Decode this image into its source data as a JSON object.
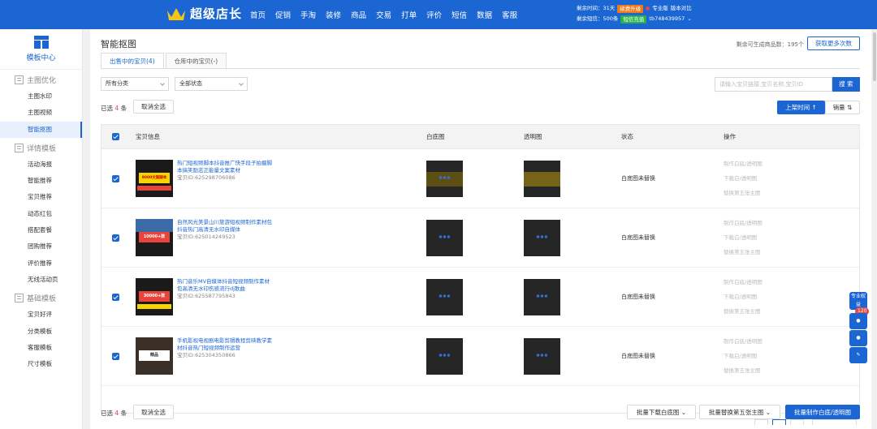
{
  "header": {
    "brand": "超级店长",
    "nav": [
      "首页",
      "促销",
      "手淘",
      "装修",
      "商品",
      "交易",
      "打单",
      "评价",
      "短信",
      "数据",
      "客服"
    ],
    "account": {
      "remaining_time_label": "剩余时间：31天",
      "upgrade_label": "续费升级",
      "pro_label": "专业版",
      "compare_label": "版本对比",
      "sms_label": "剩余短信：500条",
      "sms_buy_label": "短信充值",
      "user": "tb748439957"
    }
  },
  "sidebar": {
    "title": "模板中心",
    "groups": [
      {
        "label": "主图优化",
        "items": [
          "主图水印",
          "主图视频",
          "智能抠图"
        ]
      },
      {
        "label": "详情模板",
        "items": [
          "活动海报",
          "智能推荐",
          "宝贝推荐",
          "动态红包",
          "搭配套餐",
          "团购推荐",
          "评价推荐",
          "无线活动页"
        ]
      },
      {
        "label": "基础模板",
        "items": [
          "宝贝好评",
          "分类模板",
          "客服模板",
          "尺寸模板"
        ]
      }
    ],
    "active_item": "智能抠图"
  },
  "main": {
    "title": "智能抠图",
    "remaining": "剩余可生成商品数：195个",
    "get_more_label": "获取更多次数",
    "tabs": [
      "出售中的宝贝(4)",
      "仓库中的宝贝(-)"
    ],
    "filters": {
      "category": "所有分类",
      "status": "全部状态"
    },
    "search_placeholder": "请输入宝贝链接,宝贝名称,宝贝ID",
    "search_label": "搜 索",
    "selected_prefix": "已选",
    "selected_count": "4",
    "selected_suffix": "条",
    "cancel_select_label": "取消全选",
    "sort_time_label": "上架时间 ↑",
    "sort_sales_label": "销量 ⇅",
    "columns": [
      "宝贝信息",
      "白底图",
      "透明图",
      "状态",
      "操作"
    ],
    "rows": [
      {
        "title": "热门短视频脚本抖音推广快手段子拍摄脚本搞笑励志正能量文案素材",
        "id": "宝贝ID:625298706086",
        "status": "白底图未替换",
        "ops": [
          "制作白底/透明图",
          "下载白/透明图",
          "替换第五张主图"
        ]
      },
      {
        "title": "自然风光美景山川旅游短视频制作素材包抖音热门高清无水印自媒体",
        "id": "宝贝ID:625014249523",
        "status": "白底图未替换",
        "ops": [
          "制作白底/透明图",
          "下载白/透明图",
          "替换第五张主图"
        ]
      },
      {
        "title": "热门音乐MV自媒体抖音短视频制作素材包高清无水印伤感流行dj歌曲",
        "id": "宝贝ID:625587795843",
        "status": "白底图未替换",
        "ops": [
          "制作白底/透明图",
          "下载白/透明图",
          "替换第五张主图"
        ]
      },
      {
        "title": "手机影视电视剧电影剪辑教程剪映教学素材抖音热门短视频制作运营",
        "id": "宝贝ID:625304350866",
        "status": "白底图未替换",
        "ops": [
          "制作白底/透明图",
          "下载白/透明图",
          "替换第五张主图"
        ]
      }
    ],
    "thumb_texts": [
      "9000文案脚本",
      "10000+款",
      "30000+款",
      "精品"
    ],
    "bottom": {
      "batch_download_label": "批量下载白底图",
      "batch_replace_label": "批量替换第五张主图",
      "batch_make_label": "批量制作白底/透明图"
    }
  },
  "float_panel": {
    "pro_label": "专业权益",
    "badge": "120"
  }
}
